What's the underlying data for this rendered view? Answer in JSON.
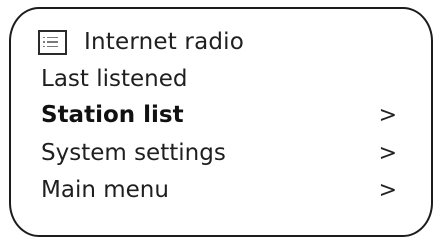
{
  "header": {
    "icon": "list-icon",
    "title": "Internet radio"
  },
  "menu": {
    "items": [
      {
        "label": "Last listened",
        "arrow": "",
        "selected": false
      },
      {
        "label": "Station list",
        "arrow": ">",
        "selected": true
      },
      {
        "label": "System settings",
        "arrow": ">",
        "selected": false
      },
      {
        "label": "Main menu",
        "arrow": ">",
        "selected": false
      }
    ]
  }
}
